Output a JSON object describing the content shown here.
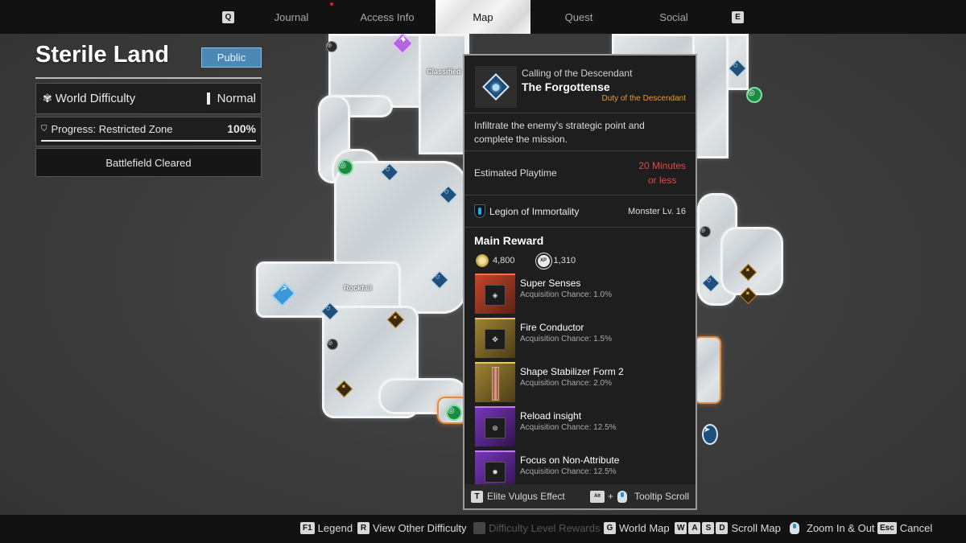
{
  "nav": {
    "prev_key": "Q",
    "next_key": "E",
    "tabs": [
      {
        "label": "Journal",
        "active": false,
        "notification": true
      },
      {
        "label": "Access Info",
        "active": false,
        "notification": false
      },
      {
        "label": "Map",
        "active": true,
        "notification": false
      },
      {
        "label": "Quest",
        "active": false,
        "notification": false
      },
      {
        "label": "Social",
        "active": false,
        "notification": false
      }
    ]
  },
  "zone": {
    "title": "Sterile Land",
    "visibility_button": "Public",
    "difficulty_label": "World Difficulty",
    "difficulty_value": "Normal",
    "progress_label": "Progress: Restricted Zone",
    "progress_value": "100%",
    "progress_fraction": 1.0,
    "status": "Battlefield Cleared"
  },
  "map": {
    "labels": [
      "Classified",
      "Rockfall"
    ],
    "markers": {
      "bookmark": "bookmark-marker-icon",
      "hub": "outpost-marker-icon",
      "resource": "resource-marker-icon",
      "lock": "locked-marker-icon",
      "special": "special-operation-marker-icon",
      "unknown": "?",
      "player": "player-position-icon"
    }
  },
  "tooltip": {
    "category": "Calling of the Descendant",
    "title": "The Forgottense",
    "type": "Duty of the Descendant",
    "description": "Infiltrate the enemy's strategic point and complete the mission.",
    "playtime_label": "Estimated Playtime",
    "playtime_value_line1": "20 Minutes",
    "playtime_value_line2": "or less",
    "enemy_faction": "Legion of Immortality",
    "monster_level": "Monster Lv. 16",
    "reward_title": "Main Reward",
    "gold": "4,800",
    "xp": "1,310",
    "xp_badge": "XP",
    "rewards": [
      {
        "name": "Super Senses",
        "chance": "Acquisition Chance: 1.0%",
        "rarity": "red"
      },
      {
        "name": "Fire Conductor",
        "chance": "Acquisition Chance: 1.5%",
        "rarity": "gold"
      },
      {
        "name": "Shape Stabilizer Form 2",
        "chance": "Acquisition Chance: 2.0%",
        "rarity": "gold"
      },
      {
        "name": "Reload insight",
        "chance": "Acquisition Chance: 12.5%",
        "rarity": "purple"
      },
      {
        "name": "Focus on Non-Attribute",
        "chance": "Acquisition Chance: 12.5%",
        "rarity": "purple"
      }
    ],
    "footer_left_key": "T",
    "footer_left_label": "Elite Vulgus Effect",
    "footer_right_key": "Alt",
    "footer_plus": "+",
    "footer_right_label": "Tooltip Scroll"
  },
  "bottom_hints": [
    {
      "keys": [
        "F1"
      ],
      "label": "Legend",
      "enabled": true
    },
    {
      "keys": [
        "R"
      ],
      "label": "View Other Difficulty",
      "enabled": true
    },
    {
      "keys": [
        "F"
      ],
      "label": "Difficulty Level Rewards",
      "enabled": false
    },
    {
      "keys": [
        "G"
      ],
      "label": "World Map",
      "enabled": true
    },
    {
      "keys": [
        "W",
        "A",
        "S",
        "D"
      ],
      "label": "Scroll Map",
      "enabled": true
    },
    {
      "keys": [],
      "label": "Zoom In & Out",
      "enabled": true,
      "icon": "mouse-wheel-icon"
    },
    {
      "keys": [
        "Esc"
      ],
      "label": "Cancel",
      "enabled": true
    }
  ]
}
